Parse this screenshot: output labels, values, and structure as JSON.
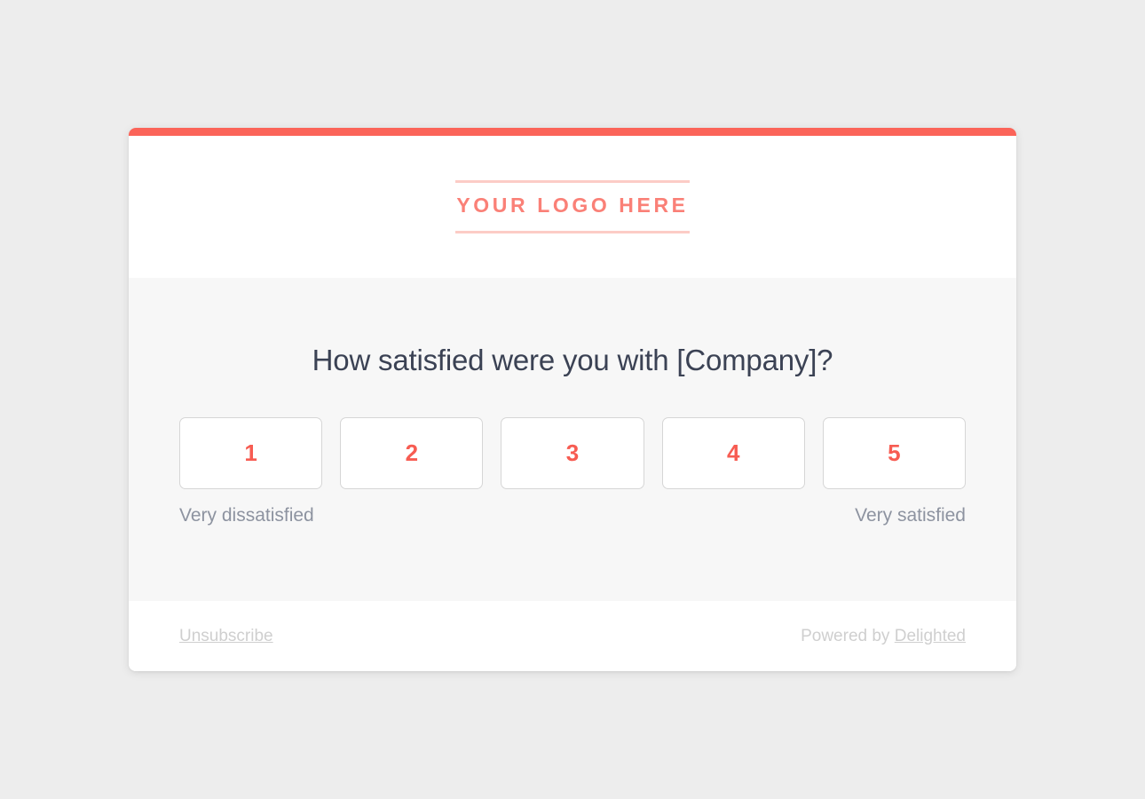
{
  "theme": {
    "page_background": "#ededed",
    "accent_color": "#fb6459",
    "logo_color": "#fa8077",
    "logo_rule_color": "#fcccc6",
    "rating_number_color": "#f75c52",
    "question_color": "#3b4254",
    "scale_label_color": "#8d93a0",
    "footer_text_color": "#cfcfcf",
    "card_background": "#ffffff",
    "body_background": "#f7f7f7",
    "button_border_color": "#d6d6d6"
  },
  "header": {
    "logo_text": "YOUR LOGO HERE"
  },
  "survey": {
    "question": "How satisfied were you with [Company]?",
    "scale": [
      {
        "value": "1"
      },
      {
        "value": "2"
      },
      {
        "value": "3"
      },
      {
        "value": "4"
      },
      {
        "value": "5"
      }
    ],
    "low_label": "Very dissatisfied",
    "high_label": "Very satisfied"
  },
  "footer": {
    "unsubscribe_label": "Unsubscribe",
    "powered_by_prefix": "Powered by ",
    "powered_by_brand": "Delighted"
  }
}
